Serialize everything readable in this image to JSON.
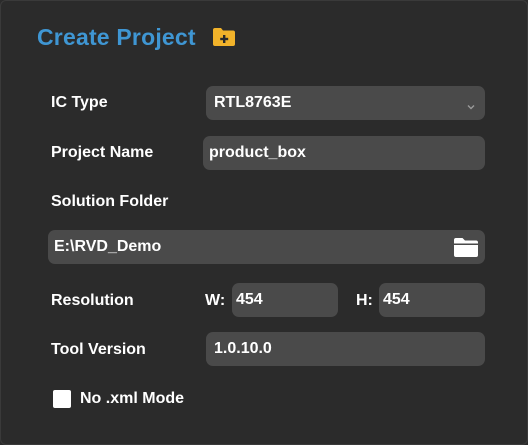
{
  "header": {
    "title": "Create Project",
    "title_icon": "folder-add-icon",
    "title_color": "#3f96d3",
    "icon_color": "#f2b32a"
  },
  "form": {
    "ic_type": {
      "label": "IC Type",
      "value": "RTL8763E",
      "icon": "chevron-down-icon"
    },
    "project_name": {
      "label": "Project Name",
      "value": "product_box"
    },
    "solution_folder": {
      "label": "Solution Folder",
      "value": "E:\\RVD_Demo",
      "icon": "folder-icon"
    },
    "resolution": {
      "label": "Resolution",
      "width_label": "W:",
      "width_value": "454",
      "height_label": "H:",
      "height_value": "454"
    },
    "tool_version": {
      "label": "Tool Version",
      "value": "1.0.10.0"
    },
    "no_xml_mode": {
      "label": "No .xml Mode",
      "checked": false
    }
  },
  "colors": {
    "background": "#2b2b2b",
    "field_background": "#4a4a4a",
    "text": "#ffffff"
  }
}
